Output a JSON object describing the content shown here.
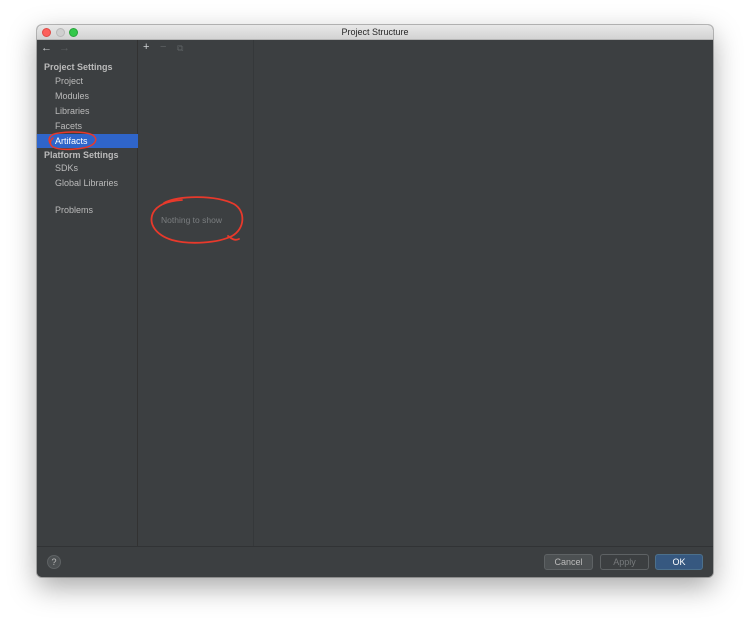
{
  "window": {
    "title": "Project Structure"
  },
  "nav": {
    "back_icon": "←",
    "forward_icon": "→"
  },
  "sidebar": {
    "project_settings_title": "Project Settings",
    "project_settings_items": [
      {
        "label": "Project"
      },
      {
        "label": "Modules"
      },
      {
        "label": "Libraries"
      },
      {
        "label": "Facets"
      },
      {
        "label": "Artifacts"
      }
    ],
    "selected_item": "Artifacts",
    "platform_settings_title": "Platform Settings",
    "platform_settings_items": [
      {
        "label": "SDKs"
      },
      {
        "label": "Global Libraries"
      }
    ],
    "problems_label": "Problems"
  },
  "toolbar": {
    "add_icon": "+",
    "remove_icon": "−",
    "copy_icon": "⧉"
  },
  "middle": {
    "empty_text": "Nothing to show"
  },
  "footer": {
    "help_label": "?",
    "cancel_label": "Cancel",
    "apply_label": "Apply",
    "ok_label": "OK"
  },
  "colors": {
    "selection": "#2f65ca",
    "annotation": "#e8392b",
    "ok_button": "#365880"
  }
}
